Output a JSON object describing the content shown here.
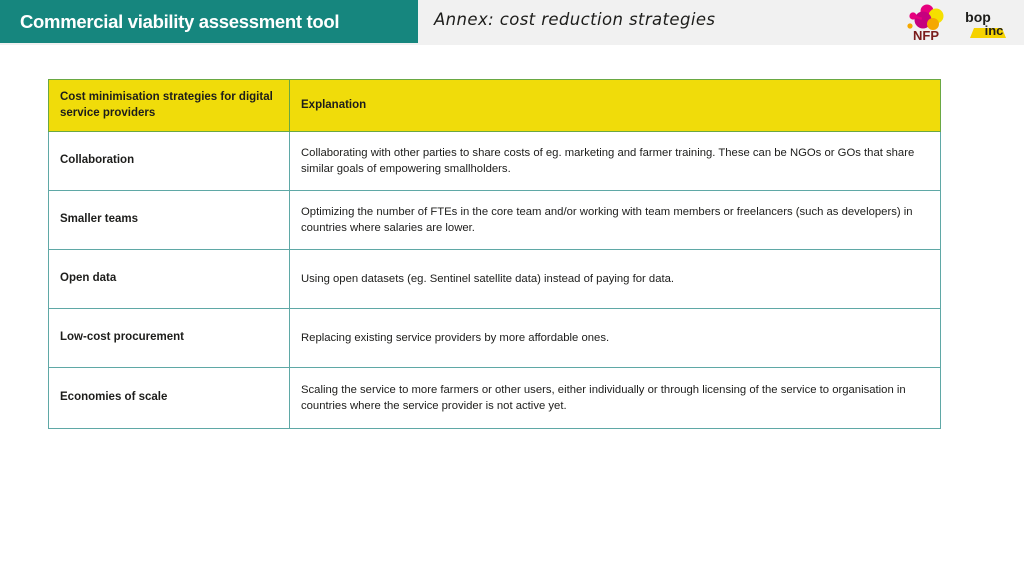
{
  "header": {
    "title": "Commercial viability assessment tool",
    "subtitle": "Annex: cost reduction strategies",
    "title_bar_color": "#16867e",
    "strip_color": "#f1f1f1",
    "logos": [
      {
        "name": "nfp-logo",
        "text": "NFP"
      },
      {
        "name": "bop-inc-logo",
        "text_top": "bop",
        "text_bottom": "inc"
      }
    ]
  },
  "table": {
    "header_background": "#f0dc0a",
    "header_border_color": "#6aa843",
    "body_border_color": "#5fa8a6",
    "columns": [
      "Cost minimisation strategies for digital service providers",
      "Explanation"
    ],
    "rows": [
      {
        "strategy": "Collaboration",
        "explanation": "Collaborating with other parties to share costs of eg. marketing and farmer training. These can be NGOs or GOs that share similar goals of empowering smallholders."
      },
      {
        "strategy": "Smaller teams",
        "explanation": "Optimizing the number of FTEs in the core team and/or working with team members or freelancers (such as developers) in countries where salaries are lower."
      },
      {
        "strategy": "Open data",
        "explanation": "Using open datasets (eg. Sentinel satellite data) instead of paying for data."
      },
      {
        "strategy": "Low-cost procurement",
        "explanation": "Replacing existing service providers by more affordable ones."
      },
      {
        "strategy": "Economies of scale",
        "explanation": "Scaling the service to more farmers or other users, either individually or through licensing of the service to organisation in countries where the service provider is not active yet."
      }
    ]
  }
}
